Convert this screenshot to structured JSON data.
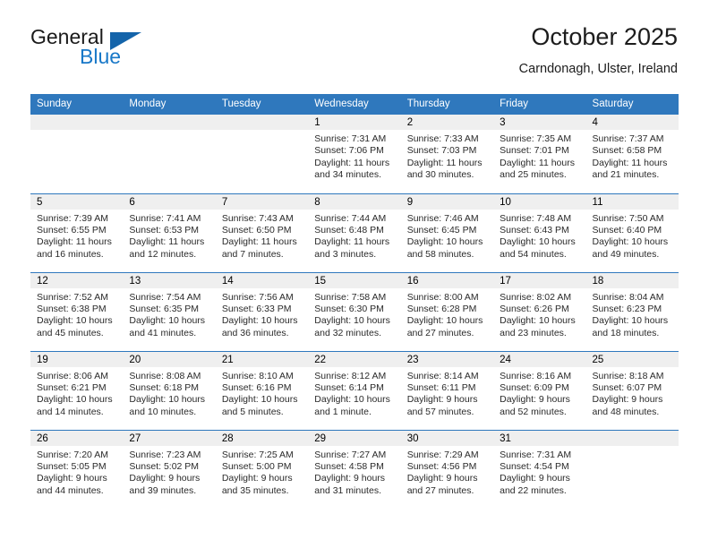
{
  "brand": {
    "name_part1": "General",
    "name_part2": "Blue",
    "logo_icon": "triangle-logo-icon",
    "accent_color": "#1464aa"
  },
  "header": {
    "title": "October 2025",
    "subtitle": "Carndonagh, Ulster, Ireland"
  },
  "theme": {
    "header_bg": "#2f78bd",
    "header_text": "#ffffff",
    "daynum_band_bg": "#efefef",
    "row_separator": "#2f78bd"
  },
  "weekdays": [
    "Sunday",
    "Monday",
    "Tuesday",
    "Wednesday",
    "Thursday",
    "Friday",
    "Saturday"
  ],
  "labels": {
    "sunrise": "Sunrise:",
    "sunset": "Sunset:",
    "daylight": "Daylight:"
  },
  "weeks": [
    [
      {
        "day": "",
        "empty": true
      },
      {
        "day": "",
        "empty": true
      },
      {
        "day": "",
        "empty": true
      },
      {
        "day": "1",
        "sunrise": "Sunrise: 7:31 AM",
        "sunset": "Sunset: 7:06 PM",
        "daylight1": "Daylight: 11 hours",
        "daylight2": "and 34 minutes."
      },
      {
        "day": "2",
        "sunrise": "Sunrise: 7:33 AM",
        "sunset": "Sunset: 7:03 PM",
        "daylight1": "Daylight: 11 hours",
        "daylight2": "and 30 minutes."
      },
      {
        "day": "3",
        "sunrise": "Sunrise: 7:35 AM",
        "sunset": "Sunset: 7:01 PM",
        "daylight1": "Daylight: 11 hours",
        "daylight2": "and 25 minutes."
      },
      {
        "day": "4",
        "sunrise": "Sunrise: 7:37 AM",
        "sunset": "Sunset: 6:58 PM",
        "daylight1": "Daylight: 11 hours",
        "daylight2": "and 21 minutes."
      }
    ],
    [
      {
        "day": "5",
        "sunrise": "Sunrise: 7:39 AM",
        "sunset": "Sunset: 6:55 PM",
        "daylight1": "Daylight: 11 hours",
        "daylight2": "and 16 minutes."
      },
      {
        "day": "6",
        "sunrise": "Sunrise: 7:41 AM",
        "sunset": "Sunset: 6:53 PM",
        "daylight1": "Daylight: 11 hours",
        "daylight2": "and 12 minutes."
      },
      {
        "day": "7",
        "sunrise": "Sunrise: 7:43 AM",
        "sunset": "Sunset: 6:50 PM",
        "daylight1": "Daylight: 11 hours",
        "daylight2": "and 7 minutes."
      },
      {
        "day": "8",
        "sunrise": "Sunrise: 7:44 AM",
        "sunset": "Sunset: 6:48 PM",
        "daylight1": "Daylight: 11 hours",
        "daylight2": "and 3 minutes."
      },
      {
        "day": "9",
        "sunrise": "Sunrise: 7:46 AM",
        "sunset": "Sunset: 6:45 PM",
        "daylight1": "Daylight: 10 hours",
        "daylight2": "and 58 minutes."
      },
      {
        "day": "10",
        "sunrise": "Sunrise: 7:48 AM",
        "sunset": "Sunset: 6:43 PM",
        "daylight1": "Daylight: 10 hours",
        "daylight2": "and 54 minutes."
      },
      {
        "day": "11",
        "sunrise": "Sunrise: 7:50 AM",
        "sunset": "Sunset: 6:40 PM",
        "daylight1": "Daylight: 10 hours",
        "daylight2": "and 49 minutes."
      }
    ],
    [
      {
        "day": "12",
        "sunrise": "Sunrise: 7:52 AM",
        "sunset": "Sunset: 6:38 PM",
        "daylight1": "Daylight: 10 hours",
        "daylight2": "and 45 minutes."
      },
      {
        "day": "13",
        "sunrise": "Sunrise: 7:54 AM",
        "sunset": "Sunset: 6:35 PM",
        "daylight1": "Daylight: 10 hours",
        "daylight2": "and 41 minutes."
      },
      {
        "day": "14",
        "sunrise": "Sunrise: 7:56 AM",
        "sunset": "Sunset: 6:33 PM",
        "daylight1": "Daylight: 10 hours",
        "daylight2": "and 36 minutes."
      },
      {
        "day": "15",
        "sunrise": "Sunrise: 7:58 AM",
        "sunset": "Sunset: 6:30 PM",
        "daylight1": "Daylight: 10 hours",
        "daylight2": "and 32 minutes."
      },
      {
        "day": "16",
        "sunrise": "Sunrise: 8:00 AM",
        "sunset": "Sunset: 6:28 PM",
        "daylight1": "Daylight: 10 hours",
        "daylight2": "and 27 minutes."
      },
      {
        "day": "17",
        "sunrise": "Sunrise: 8:02 AM",
        "sunset": "Sunset: 6:26 PM",
        "daylight1": "Daylight: 10 hours",
        "daylight2": "and 23 minutes."
      },
      {
        "day": "18",
        "sunrise": "Sunrise: 8:04 AM",
        "sunset": "Sunset: 6:23 PM",
        "daylight1": "Daylight: 10 hours",
        "daylight2": "and 18 minutes."
      }
    ],
    [
      {
        "day": "19",
        "sunrise": "Sunrise: 8:06 AM",
        "sunset": "Sunset: 6:21 PM",
        "daylight1": "Daylight: 10 hours",
        "daylight2": "and 14 minutes."
      },
      {
        "day": "20",
        "sunrise": "Sunrise: 8:08 AM",
        "sunset": "Sunset: 6:18 PM",
        "daylight1": "Daylight: 10 hours",
        "daylight2": "and 10 minutes."
      },
      {
        "day": "21",
        "sunrise": "Sunrise: 8:10 AM",
        "sunset": "Sunset: 6:16 PM",
        "daylight1": "Daylight: 10 hours",
        "daylight2": "and 5 minutes."
      },
      {
        "day": "22",
        "sunrise": "Sunrise: 8:12 AM",
        "sunset": "Sunset: 6:14 PM",
        "daylight1": "Daylight: 10 hours",
        "daylight2": "and 1 minute."
      },
      {
        "day": "23",
        "sunrise": "Sunrise: 8:14 AM",
        "sunset": "Sunset: 6:11 PM",
        "daylight1": "Daylight: 9 hours",
        "daylight2": "and 57 minutes."
      },
      {
        "day": "24",
        "sunrise": "Sunrise: 8:16 AM",
        "sunset": "Sunset: 6:09 PM",
        "daylight1": "Daylight: 9 hours",
        "daylight2": "and 52 minutes."
      },
      {
        "day": "25",
        "sunrise": "Sunrise: 8:18 AM",
        "sunset": "Sunset: 6:07 PM",
        "daylight1": "Daylight: 9 hours",
        "daylight2": "and 48 minutes."
      }
    ],
    [
      {
        "day": "26",
        "sunrise": "Sunrise: 7:20 AM",
        "sunset": "Sunset: 5:05 PM",
        "daylight1": "Daylight: 9 hours",
        "daylight2": "and 44 minutes."
      },
      {
        "day": "27",
        "sunrise": "Sunrise: 7:23 AM",
        "sunset": "Sunset: 5:02 PM",
        "daylight1": "Daylight: 9 hours",
        "daylight2": "and 39 minutes."
      },
      {
        "day": "28",
        "sunrise": "Sunrise: 7:25 AM",
        "sunset": "Sunset: 5:00 PM",
        "daylight1": "Daylight: 9 hours",
        "daylight2": "and 35 minutes."
      },
      {
        "day": "29",
        "sunrise": "Sunrise: 7:27 AM",
        "sunset": "Sunset: 4:58 PM",
        "daylight1": "Daylight: 9 hours",
        "daylight2": "and 31 minutes."
      },
      {
        "day": "30",
        "sunrise": "Sunrise: 7:29 AM",
        "sunset": "Sunset: 4:56 PM",
        "daylight1": "Daylight: 9 hours",
        "daylight2": "and 27 minutes."
      },
      {
        "day": "31",
        "sunrise": "Sunrise: 7:31 AM",
        "sunset": "Sunset: 4:54 PM",
        "daylight1": "Daylight: 9 hours",
        "daylight2": "and 22 minutes."
      },
      {
        "day": "",
        "empty": true
      }
    ]
  ]
}
